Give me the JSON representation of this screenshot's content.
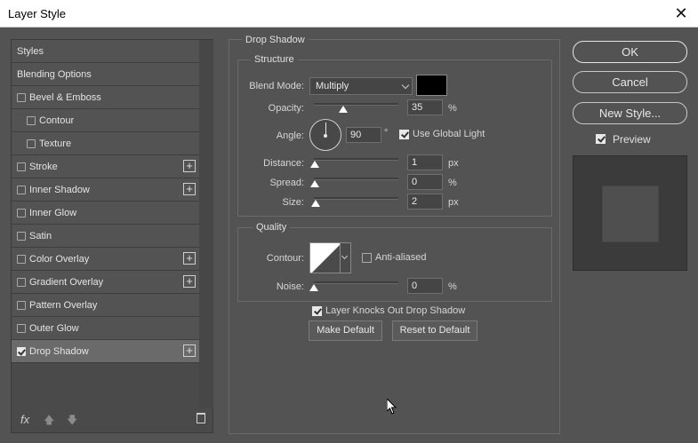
{
  "window": {
    "title": "Layer Style",
    "close_glyph": "✕"
  },
  "styles_panel": {
    "items": [
      {
        "label": "Styles",
        "checkbox": false,
        "checked": false,
        "plus": false,
        "indent": false
      },
      {
        "label": "Blending Options",
        "checkbox": false,
        "checked": false,
        "plus": false,
        "indent": false
      },
      {
        "label": "Bevel & Emboss",
        "checkbox": true,
        "checked": false,
        "plus": false,
        "indent": false
      },
      {
        "label": "Contour",
        "checkbox": true,
        "checked": false,
        "plus": false,
        "indent": true
      },
      {
        "label": "Texture",
        "checkbox": true,
        "checked": false,
        "plus": false,
        "indent": true
      },
      {
        "label": "Stroke",
        "checkbox": true,
        "checked": false,
        "plus": true,
        "indent": false
      },
      {
        "label": "Inner Shadow",
        "checkbox": true,
        "checked": false,
        "plus": true,
        "indent": false
      },
      {
        "label": "Inner Glow",
        "checkbox": true,
        "checked": false,
        "plus": false,
        "indent": false
      },
      {
        "label": "Satin",
        "checkbox": true,
        "checked": false,
        "plus": false,
        "indent": false
      },
      {
        "label": "Color Overlay",
        "checkbox": true,
        "checked": false,
        "plus": true,
        "indent": false
      },
      {
        "label": "Gradient Overlay",
        "checkbox": true,
        "checked": false,
        "plus": true,
        "indent": false
      },
      {
        "label": "Pattern Overlay",
        "checkbox": true,
        "checked": false,
        "plus": false,
        "indent": false
      },
      {
        "label": "Outer Glow",
        "checkbox": true,
        "checked": false,
        "plus": false,
        "indent": false
      },
      {
        "label": "Drop Shadow",
        "checkbox": true,
        "checked": true,
        "plus": true,
        "indent": false,
        "selected": true
      }
    ],
    "fx_label": "fx",
    "plus_glyph": "+",
    "up_glyph": "🡅",
    "down_glyph": "🡇"
  },
  "drop_shadow": {
    "title": "Drop Shadow",
    "structure": {
      "title": "Structure",
      "blend_mode_label": "Blend Mode:",
      "blend_mode_value": "Multiply",
      "shadow_color": "#000000",
      "opacity_label": "Opacity:",
      "opacity_value": "35",
      "opacity_unit": "%",
      "angle_label": "Angle:",
      "angle_value": "90",
      "angle_unit": "°",
      "use_global_light_label": "Use Global Light",
      "use_global_light": true,
      "distance_label": "Distance:",
      "distance_value": "1",
      "distance_unit": "px",
      "spread_label": "Spread:",
      "spread_value": "0",
      "spread_unit": "%",
      "size_label": "Size:",
      "size_value": "2",
      "size_unit": "px"
    },
    "quality": {
      "title": "Quality",
      "contour_label": "Contour:",
      "anti_aliased_label": "Anti-aliased",
      "anti_aliased": false,
      "noise_label": "Noise:",
      "noise_value": "0",
      "noise_unit": "%"
    },
    "knockout_label": "Layer Knocks Out Drop Shadow",
    "knockout": true,
    "make_default_label": "Make Default",
    "reset_default_label": "Reset to Default"
  },
  "actions": {
    "ok_label": "OK",
    "cancel_label": "Cancel",
    "new_style_label": "New Style...",
    "preview_label": "Preview",
    "preview": true
  }
}
